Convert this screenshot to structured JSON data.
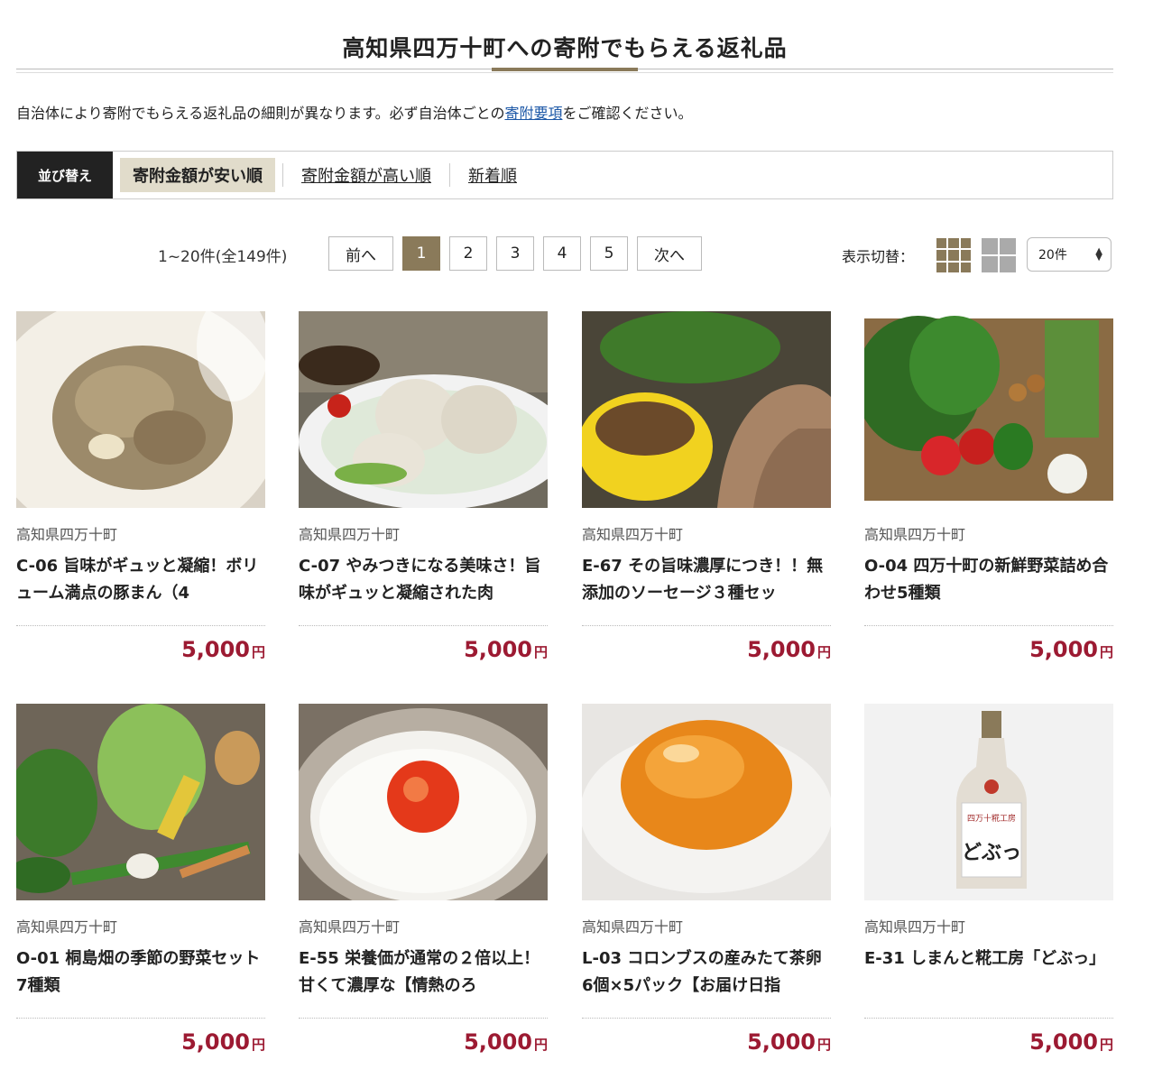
{
  "page": {
    "title": "高知県四万十町への寄附でもらえる返礼品",
    "notice_before": "自治体により寄附でもらえる返礼品の細則が異なります。必ず自治体ごとの",
    "notice_link": "寄附要項",
    "notice_after": "をご確認ください。"
  },
  "sort": {
    "label": "並び替え",
    "options": [
      "寄附金額が安い順",
      "寄附金額が高い順",
      "新着順"
    ],
    "active": "寄附金額が安い順"
  },
  "pagination": {
    "count_text": "1~20件(全149件)",
    "prev": "前へ",
    "pages": [
      "1",
      "2",
      "3",
      "4",
      "5"
    ],
    "current": "1",
    "next": "次へ"
  },
  "view": {
    "label": "表示切替：",
    "grid_large_icon": "grid-3x3-icon",
    "grid_small_icon": "grid-2x2-icon",
    "per_page": "20件"
  },
  "colors": {
    "accent": "#8a7a5a",
    "price": "#9c1a32",
    "link": "#1a56a6",
    "active_sort_bg": "#e1dccb"
  },
  "products": [
    {
      "municipality": "高知県四万十町",
      "name": "C-06 旨味がギュッと凝縮！ボリューム満点の豚まん（4",
      "price": "5,000",
      "unit": "円"
    },
    {
      "municipality": "高知県四万十町",
      "name": "C-07 やみつきになる美味さ！旨味がギュッと凝縮された肉",
      "price": "5,000",
      "unit": "円"
    },
    {
      "municipality": "高知県四万十町",
      "name": "E-67 その旨味濃厚につき！！無添加のソーセージ３種セッ",
      "price": "5,000",
      "unit": "円"
    },
    {
      "municipality": "高知県四万十町",
      "name": "O-04 四万十町の新鮮野菜詰め合わせ5種類",
      "price": "5,000",
      "unit": "円"
    },
    {
      "municipality": "高知県四万十町",
      "name": "O-01 桐島畑の季節の野菜セット　7種類",
      "price": "5,000",
      "unit": "円"
    },
    {
      "municipality": "高知県四万十町",
      "name": "E-55 栄養価が通常の２倍以上！甘くて濃厚な【情熱のろ",
      "price": "5,000",
      "unit": "円"
    },
    {
      "municipality": "高知県四万十町",
      "name": "L-03 コロンブスの産みたて茶卵 6個×5パック【お届け日指",
      "price": "5,000",
      "unit": "円"
    },
    {
      "municipality": "高知県四万十町",
      "name": "E-31 しまんと糀工房「どぶっ」",
      "price": "5,000",
      "unit": "円"
    }
  ],
  "bottle_label": {
    "brand": "四万十糀工房",
    "title": "どぶっ"
  }
}
